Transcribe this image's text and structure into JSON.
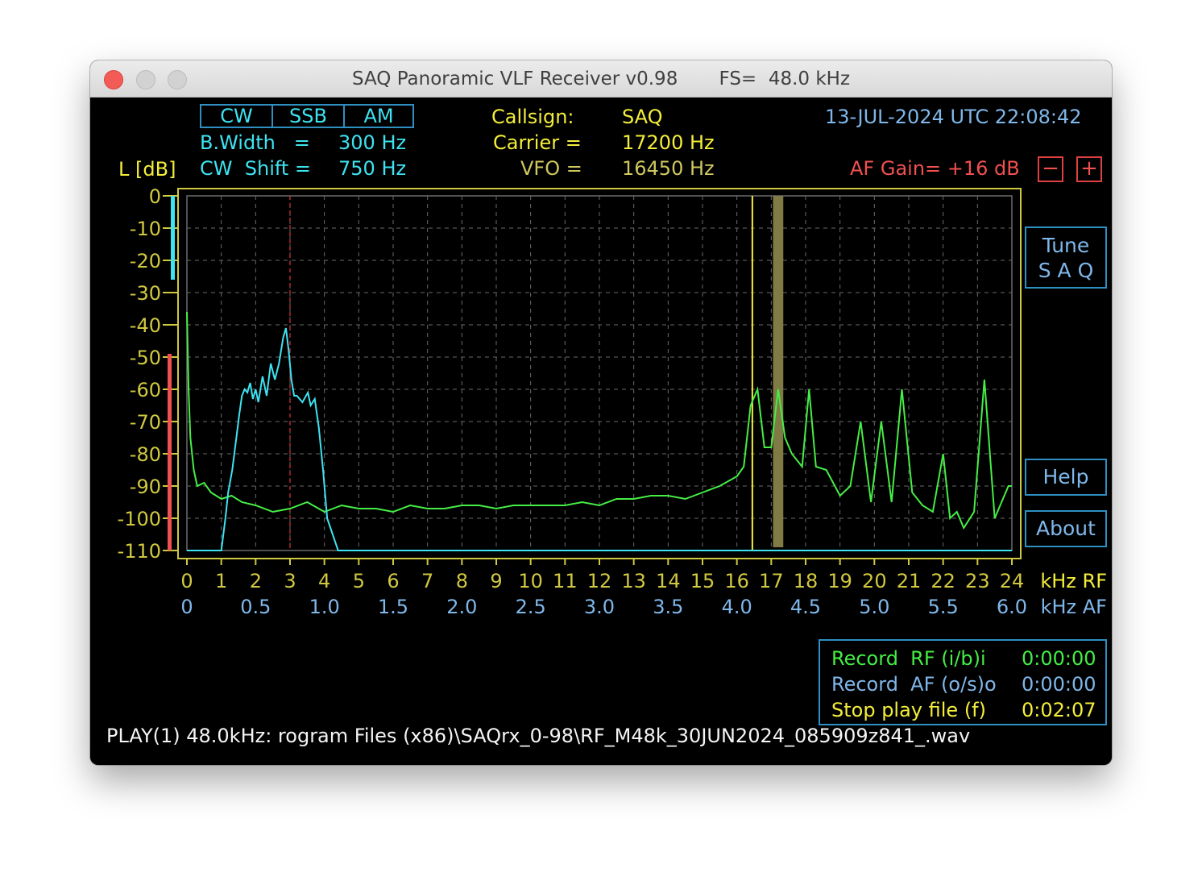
{
  "window": {
    "title": "SAQ Panoramic VLF Receiver v0.98       FS=  48.0 kHz"
  },
  "modes": [
    "CW",
    "SSB",
    "AM"
  ],
  "params": {
    "bwidth_label": "B.Width   =",
    "bwidth_value": "300 Hz",
    "shift_label": "CW  Shift =",
    "shift_value": "750 Hz",
    "callsign_label": "Callsign:",
    "callsign_value": "SAQ",
    "carrier_label": "Carrier =",
    "carrier_value": "17200 Hz",
    "vfo_label": "VFO =",
    "vfo_value": "16450 Hz"
  },
  "datetime": "13-JUL-2024 UTC 22:08:42",
  "af_gain": {
    "label": "AF Gain= +16 dB",
    "minus": "−",
    "plus": "+"
  },
  "level_label": "L [dB]",
  "buttons": {
    "tune_line1": "Tune",
    "tune_line2": "S A Q",
    "help": "Help",
    "about": "About"
  },
  "axis": {
    "rf_unit": "kHz RF",
    "af_unit": "kHz AF"
  },
  "record": {
    "rf_label": "Record  RF (i/b)i",
    "rf_time": "0:00:00",
    "af_label": "Record  AF (o/s)o",
    "af_time": "0:00:00",
    "stop_label": "Stop play file (f)",
    "stop_time": "0:02:07"
  },
  "status_line": "PLAY(1) 48.0kHz: rogram Files (x86)\\SAQrx_0-98\\RF_M48k_30JUN2024_085909z841_.wav",
  "colors": {
    "rf_trace": "#45ee45",
    "af_trace": "#3ee3f2",
    "vfo_marker": "#f4ee3a",
    "carrier_band": "#807a45",
    "grid": "#6a6a6a",
    "frame": "#d0c840"
  },
  "chart_data": {
    "type": "line",
    "ylabel": "L [dB]",
    "ylim": [
      -110,
      0
    ],
    "y_ticks": [
      "0",
      "-10",
      "-20",
      "-30",
      "-40",
      "-50",
      "-60",
      "-70",
      "-80",
      "-90",
      "-100",
      "-110"
    ],
    "x_ticks_rf": [
      "0",
      "1",
      "2",
      "3",
      "4",
      "5",
      "6",
      "7",
      "8",
      "9",
      "10",
      "11",
      "12",
      "13",
      "14",
      "15",
      "16",
      "17",
      "18",
      "19",
      "20",
      "21",
      "22",
      "23",
      "24"
    ],
    "x_ticks_af": [
      "0",
      "0.5",
      "1.0",
      "1.5",
      "2.0",
      "2.5",
      "3.0",
      "3.5",
      "4.0",
      "4.5",
      "5.0",
      "5.5",
      "6.0"
    ],
    "xlim_rf_khz": [
      0,
      24
    ],
    "xlim_af_khz": [
      0,
      6
    ],
    "vfo_marker_khz": 16.45,
    "carrier_band_khz": [
      17.05,
      17.35
    ],
    "af_cursor_khz": 0.75,
    "series": [
      {
        "x": [
          0,
          0.05,
          0.1,
          0.2,
          0.3,
          0.5,
          0.7,
          1.0,
          1.3,
          1.6,
          2.0,
          2.5,
          3.0,
          3.5,
          4.0,
          4.5,
          5.0,
          5.5,
          6.0,
          6.5,
          7.0,
          7.5,
          8.0,
          8.5,
          9.0,
          9.5,
          10.0,
          10.5,
          11.0,
          11.5,
          12.0,
          12.5,
          13.0,
          13.5,
          14.0,
          14.5,
          15.0,
          15.5,
          16.0,
          16.2,
          16.4,
          16.6,
          16.8,
          17.0,
          17.2,
          17.4,
          17.6,
          17.9,
          18.1,
          18.3,
          18.6,
          19.0,
          19.3,
          19.6,
          19.9,
          20.2,
          20.5,
          20.8,
          21.1,
          21.4,
          21.7,
          22.0,
          22.2,
          22.4,
          22.6,
          22.9,
          23.2,
          23.5,
          23.9,
          24.0
        ],
        "y": [
          -36,
          -60,
          -75,
          -85,
          -90,
          -89,
          -92,
          -94,
          -93,
          -95,
          -96,
          -98,
          -97,
          -95,
          -98,
          -96,
          -97,
          -97,
          -98,
          -96,
          -97,
          -97,
          -96,
          -96,
          -97,
          -96,
          -96,
          -96,
          -96,
          -95,
          -96,
          -94,
          -94,
          -93,
          -93,
          -94,
          -92,
          -90,
          -87,
          -84,
          -65,
          -60,
          -78,
          -78,
          -60,
          -75,
          -80,
          -84,
          -60,
          -84,
          -85,
          -93,
          -90,
          -70,
          -95,
          -70,
          -95,
          -60,
          -92,
          -96,
          -98,
          -80,
          -100,
          -98,
          -103,
          -98,
          -57,
          -100,
          -90,
          -90
        ]
      },
      {
        "x": [
          0,
          0.2,
          0.25,
          0.28,
          0.3,
          0.33,
          0.36,
          0.38,
          0.4,
          0.42,
          0.44,
          0.46,
          0.48,
          0.5,
          0.52,
          0.55,
          0.58,
          0.61,
          0.64,
          0.67,
          0.7,
          0.72,
          0.74,
          0.76,
          0.78,
          0.8,
          0.84,
          0.88,
          0.9,
          0.93,
          0.96,
          0.99,
          1.02,
          1.1,
          1.5,
          2.0,
          3.0,
          4.0,
          5.0,
          6.0
        ],
        "y": [
          -110,
          -110,
          -110,
          -100,
          -92,
          -85,
          -75,
          -68,
          -62,
          -60,
          -61,
          -58,
          -63,
          -60,
          -64,
          -56,
          -62,
          -52,
          -57,
          -52,
          -44,
          -41,
          -48,
          -57,
          -62,
          -62,
          -64,
          -61,
          -65,
          -63,
          -72,
          -85,
          -100,
          -110,
          -110,
          -110,
          -110,
          -110,
          -110,
          -110
        ]
      }
    ]
  }
}
